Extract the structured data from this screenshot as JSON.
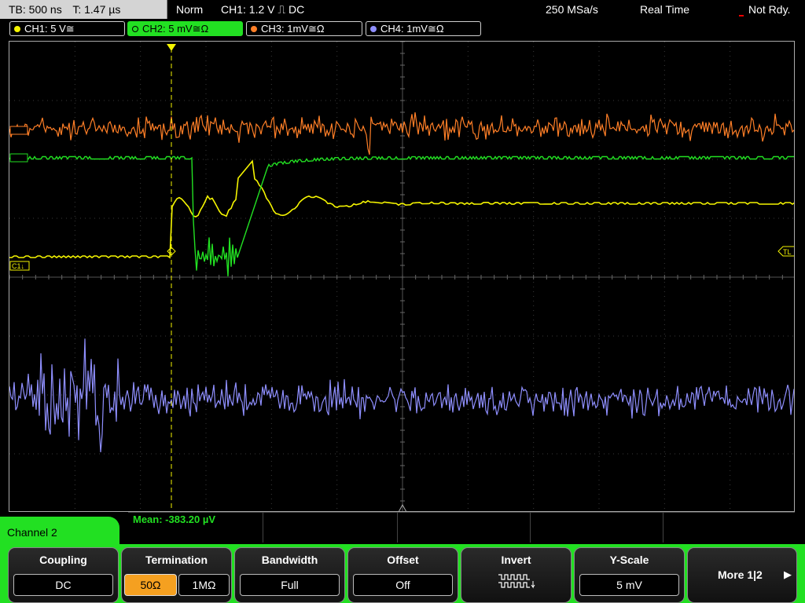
{
  "status": {
    "timebase": "TB: 500 ns",
    "trigger_time": "T: 1.47 µs",
    "mode": "Norm",
    "trigger": "CH1: 1.2 V ⎍ DC",
    "sample_rate": "250 MSa/s",
    "acquisition": "Real Time",
    "state": "Not Rdy."
  },
  "channels": [
    {
      "label": "CH1: 5 V≅",
      "color": "#f5f500"
    },
    {
      "label": "CH2: 5 mV≅Ω",
      "color": "#22e022"
    },
    {
      "label": "CH3: 1mV≅Ω",
      "color": "#ff7f27"
    },
    {
      "label": "CH4: 1mV≅Ω",
      "color": "#8f8fff"
    }
  ],
  "markers": {
    "c1": "C1↓",
    "tl": "TL"
  },
  "measurement": {
    "mean": "Mean: -383.20 µV"
  },
  "menu": {
    "title": "Channel 2",
    "coupling": {
      "title": "Coupling",
      "value": "DC"
    },
    "termination": {
      "title": "Termination",
      "opt1": "50Ω",
      "opt2": "1MΩ"
    },
    "bandwidth": {
      "title": "Bandwidth",
      "value": "Full"
    },
    "offset": {
      "title": "Offset",
      "value": "Off"
    },
    "invert": {
      "title": "Invert"
    },
    "yscale": {
      "title": "Y-Scale",
      "value": "5 mV"
    },
    "more": {
      "label": "More 1|2",
      "arrow": "▶"
    }
  },
  "colors": {
    "ch1": "#f5f500",
    "ch2": "#22e022",
    "ch3": "#ff7f27",
    "ch4": "#8f8fff",
    "accent": "#22e022",
    "selected_option": "#f5a020"
  }
}
